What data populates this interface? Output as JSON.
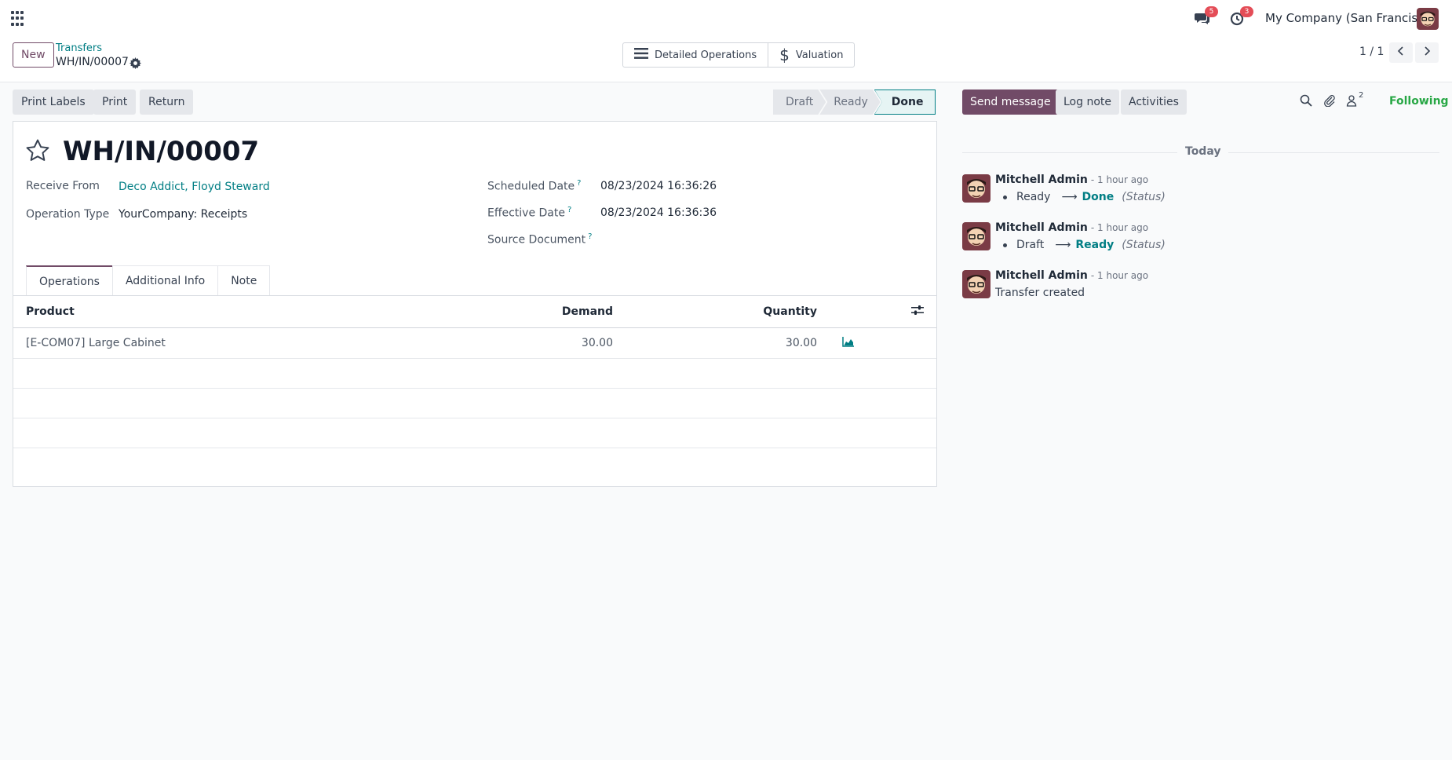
{
  "navbar": {
    "discuss_badge": "5",
    "activity_badge": "3",
    "company": "My Company (San Francisco)"
  },
  "control": {
    "new_label": "New",
    "breadcrumb": "Transfers",
    "record": "WH/IN/00007",
    "smart_buttons": [
      "Detailed Operations",
      "Valuation"
    ],
    "pager": "1 / 1"
  },
  "actions": [
    "Print Labels",
    "Print",
    "Return"
  ],
  "statusbar": [
    "Draft",
    "Ready",
    "Done"
  ],
  "form": {
    "title": "WH/IN/00007",
    "receive_from_label": "Receive From",
    "receive_from": "Deco Addict, Floyd Steward",
    "operation_type_label": "Operation Type",
    "operation_type": "YourCompany: Receipts",
    "scheduled_date_label": "Scheduled Date",
    "scheduled_date": "08/23/2024 16:36:26",
    "effective_date_label": "Effective Date",
    "effective_date": "08/23/2024 16:36:36",
    "source_document_label": "Source Document",
    "help_mark": "?",
    "tabs": [
      "Operations",
      "Additional Info",
      "Note"
    ]
  },
  "operations": {
    "columns": [
      "Product",
      "Demand",
      "Quantity"
    ],
    "rows": [
      {
        "product": "[E-COM07] Large Cabinet",
        "demand": "30.00",
        "quantity": "30.00"
      }
    ]
  },
  "chatter": {
    "send_message": "Send message",
    "log_note": "Log note",
    "activities": "Activities",
    "followers_count": "2",
    "following": "Following",
    "today": "Today",
    "messages": [
      {
        "author": "Mitchell Admin",
        "date": "- 1 hour ago",
        "old": "Ready",
        "arrow": "⟶",
        "new": "Done",
        "field": "(Status)"
      },
      {
        "author": "Mitchell Admin",
        "date": "- 1 hour ago",
        "old": "Draft",
        "arrow": "⟶",
        "new": "Ready",
        "field": "(Status)"
      },
      {
        "author": "Mitchell Admin",
        "date": "- 1 hour ago",
        "body": "Transfer created"
      }
    ]
  },
  "colors": {
    "brand": "#714b67",
    "accent": "#017e84",
    "badge": "#e44d57",
    "following": "#28a745"
  }
}
